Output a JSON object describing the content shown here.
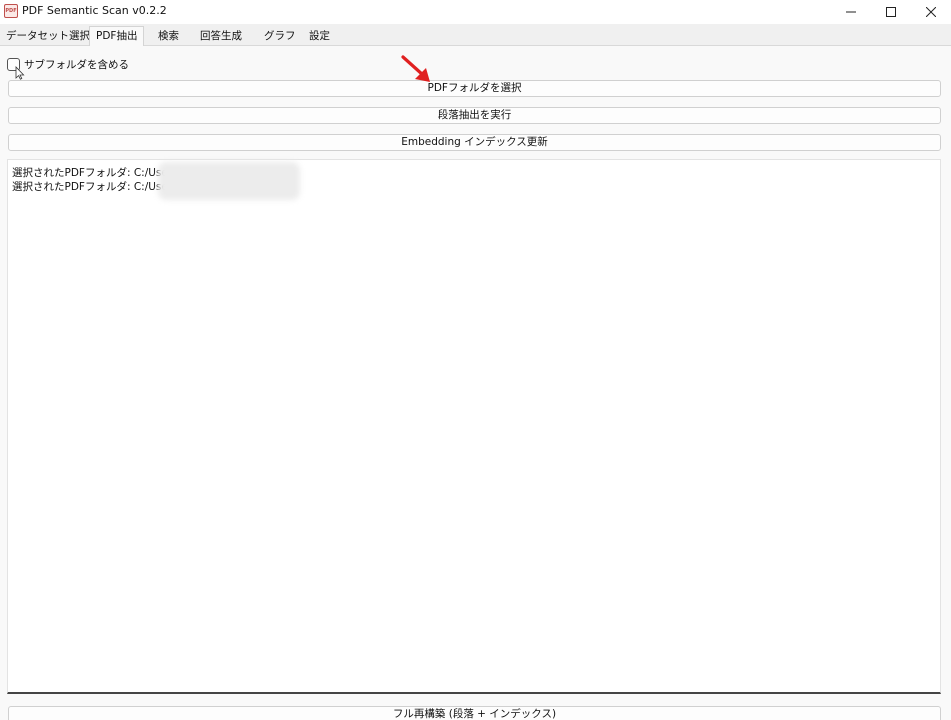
{
  "window": {
    "title": "PDF Semantic Scan v0.2.2",
    "icon": "pdf-app-icon",
    "icon_text": "PDF",
    "controls": {
      "minimize": "–",
      "maximize": "□",
      "close": "✕"
    }
  },
  "tabs": [
    {
      "label": "データセット選択",
      "active": false
    },
    {
      "label": "PDF抽出",
      "active": true
    },
    {
      "label": "検索",
      "active": false
    },
    {
      "label": "回答生成",
      "active": false
    },
    {
      "label": "グラフ",
      "active": false
    },
    {
      "label": "設定",
      "active": false
    }
  ],
  "pdf_extract": {
    "include_subfolders": {
      "label": "サブフォルダを含める",
      "checked": false
    },
    "select_folder_label": "PDFフォルダを選択",
    "extract_paragraphs_label": "段落抽出を実行",
    "update_index_label": "Embedding インデックス更新",
    "log_lines": [
      "選択されたPDFフォルダ: C:/Users/",
      "選択されたPDFフォルダ: C:/Users/"
    ],
    "full_rebuild_label": "フル再構築 (段落 + インデックス)"
  },
  "colors": {
    "annotation_arrow": "#e02020",
    "accent_border": "#444444"
  }
}
